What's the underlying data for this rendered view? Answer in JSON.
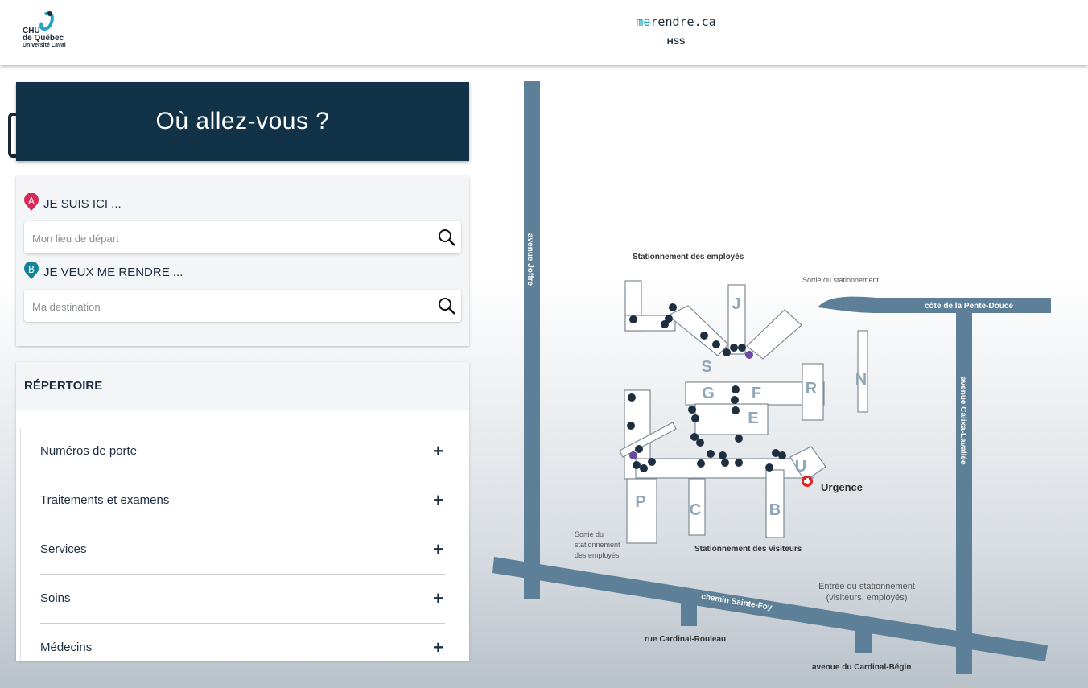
{
  "header": {
    "logo": {
      "line1": "CHU",
      "line2": "de Québec",
      "line3": "Université Laval"
    },
    "brand_prefix": "me",
    "brand_suffix": "rendre.ca",
    "subtitle": "HSS"
  },
  "hero": {
    "title": "Où allez-vous ?"
  },
  "search": {
    "start": {
      "pin_letter": "A",
      "label": "JE SUIS ICI ...",
      "placeholder": "Mon lieu de départ"
    },
    "destination": {
      "pin_letter": "B",
      "label": "JE VEUX ME RENDRE ...",
      "placeholder": "Ma destination"
    }
  },
  "directory": {
    "title": "RÉPERTOIRE",
    "items": [
      {
        "label": "Numéros de porte",
        "icon": "+"
      },
      {
        "label": "Traitements et examens",
        "icon": "+"
      },
      {
        "label": "Services",
        "icon": "+"
      },
      {
        "label": "Soins",
        "icon": "+"
      },
      {
        "label": "Médecins",
        "icon": "+"
      }
    ]
  },
  "map": {
    "streets": {
      "joffre": "avenue Joffre",
      "pente_douce": "côte de la Pente-Douce",
      "calixa": "avenue Calixa-Lavallée",
      "sainte_foy": "chemin Sainte-Foy",
      "rouleau": "rue Cardinal-Rouleau",
      "begin": "avenue du Cardinal-Bégin"
    },
    "labels": {
      "employee_parking": "Stationnement des employés",
      "parking_exit": "Sortie du stationnement",
      "employee_parking_exit_1": "Sortie du",
      "employee_parking_exit_2": "stationnement",
      "employee_parking_exit_3": "des employés",
      "visitor_parking": "Stationnement des visiteurs",
      "parking_entry_1": "Entrée du stationnement",
      "parking_entry_2": "(visiteurs, employés)",
      "emergency": "Urgence"
    },
    "wings": [
      "J",
      "S",
      "G",
      "F",
      "R",
      "N",
      "E",
      "U",
      "P",
      "C",
      "B"
    ],
    "colors": {
      "street": "#5d7f97",
      "building": "#ffffff",
      "wing_letter": "#8ea6b8",
      "marker": "#1d2e40",
      "emergency": "#e02424"
    }
  },
  "colors": {
    "hero_bg": "#123247",
    "pin_a": "#d42a5b",
    "pin_b": "#12849a",
    "text": "#1d2e40"
  }
}
